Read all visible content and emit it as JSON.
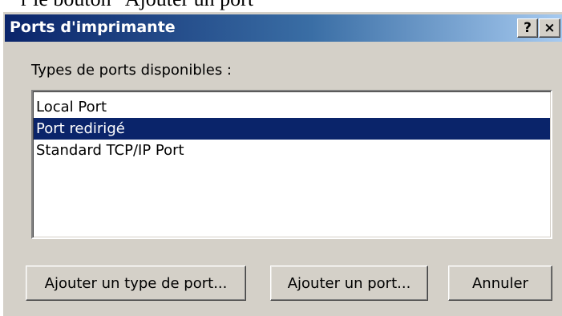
{
  "page": {
    "caption": "r le bouton \"Ajouter un port\""
  },
  "dialog": {
    "title": "Ports d'imprimante",
    "help_label": "?",
    "close_label": "×"
  },
  "ports": {
    "label": "Types de ports disponibles :",
    "items": [
      {
        "label": "Local Port",
        "selected": false
      },
      {
        "label": "Port redirigé",
        "selected": true
      },
      {
        "label": "Standard TCP/IP Port",
        "selected": false
      }
    ]
  },
  "buttons": {
    "add_port_type": "Ajouter un type de port...",
    "add_port": "Ajouter un port...",
    "cancel": "Annuler"
  },
  "colors": {
    "dialog_bg": "#d4d0c8",
    "titlebar_start": "#0a246a",
    "titlebar_end": "#a6caf0",
    "selection": "#0a246a"
  }
}
